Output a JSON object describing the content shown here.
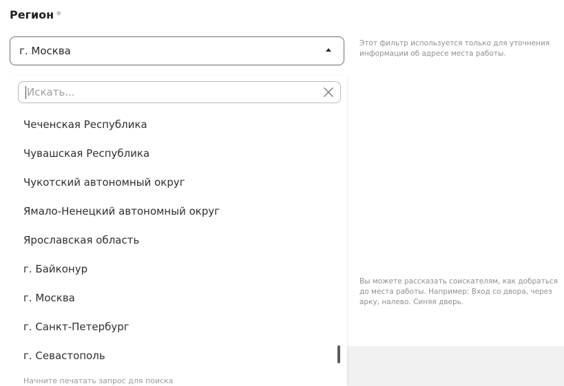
{
  "region": {
    "label": "Регион",
    "required_mark": "*",
    "selected_value": "г. Москва"
  },
  "dropdown": {
    "search_placeholder": "Искать...",
    "options": [
      "Чеченская Республика",
      "Чувашская Республика",
      "Чукотский автономный округ",
      "Ямало-Ненецкий автономный округ",
      "Ярославская область",
      "г. Байконур",
      "г. Москва",
      "г. Санкт-Петербург",
      "г. Севастополь"
    ],
    "hint": "Начните печатать запрос для поиска"
  },
  "help": {
    "filter_note": "Этот фильтр используется только для уточнения информации об адресе места работы.",
    "directions_note": "Вы можете рассказать соискателям, как добраться до места работы. Например: Вход со двора, через арку, налево. Синяя дверь."
  },
  "colors": {
    "border": "#6f6f6f",
    "text": "#2b2b2b",
    "muted": "#8f8f8f"
  },
  "icons": {
    "caret": "caret-up-icon",
    "clear": "close-icon"
  }
}
